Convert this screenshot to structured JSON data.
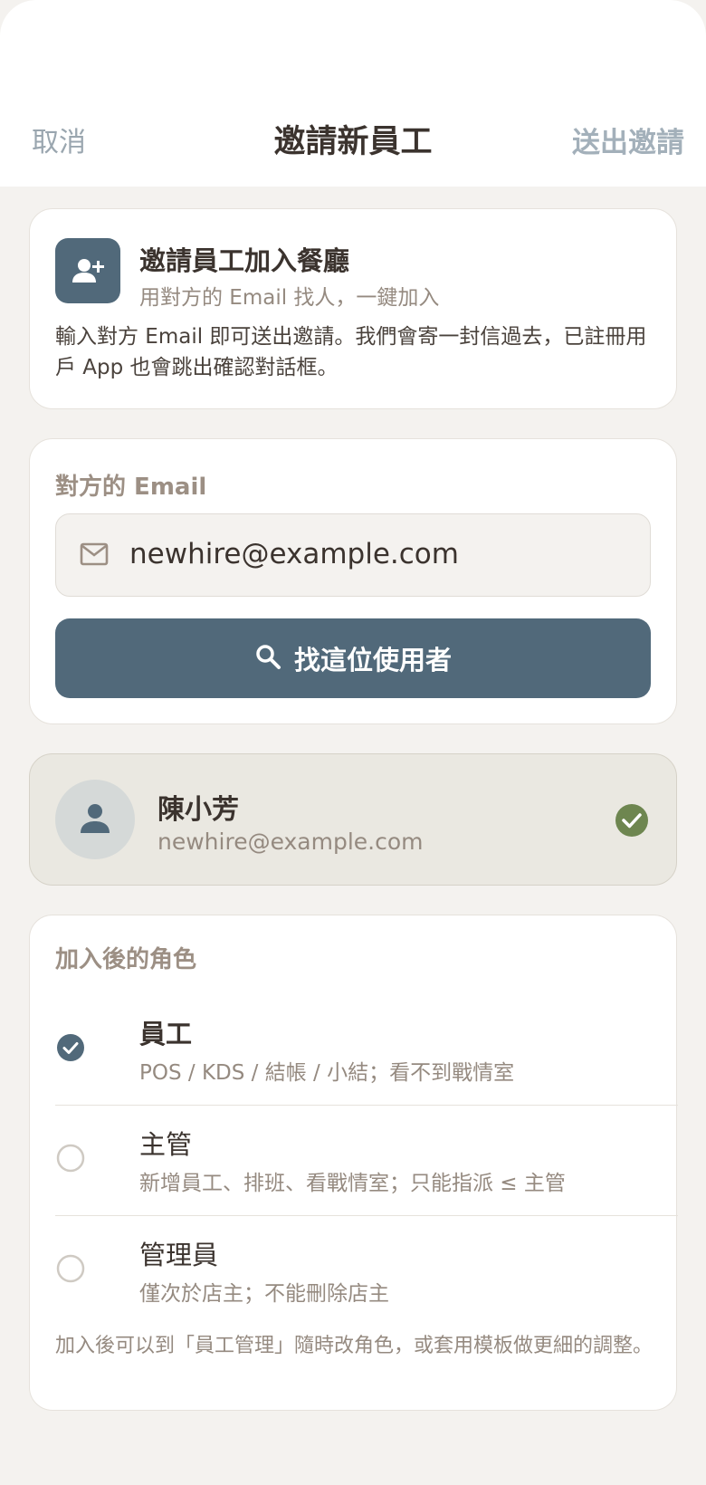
{
  "nav": {
    "cancel_label": "取消",
    "title": "邀請新員工",
    "send_label": "送出邀請"
  },
  "intro": {
    "icon": "add-person-icon",
    "title": "邀請員工加入餐廳",
    "subtitle": "用對方的 Email 找人，一鍵加入",
    "body": "輸入對方 Email 即可送出邀請。我們會寄一封信過去，已註冊用戶 App 也會跳出確認對話框。"
  },
  "email_section": {
    "label": "對方的 Email",
    "icon": "mail-icon",
    "value": "newhire@example.com",
    "find_button_icon": "search-icon",
    "find_button_label": "找這位使用者"
  },
  "found_user": {
    "icon": "person-icon",
    "name": "陳小芳",
    "email": "newhire@example.com",
    "status_icon": "check-circle-icon"
  },
  "role_section": {
    "label": "加入後的角色",
    "roles": [
      {
        "name": "員工",
        "description": "POS / KDS / 結帳 / 小結；看不到戰情室",
        "selected": true
      },
      {
        "name": "主管",
        "description": "新增員工、排班、看戰情室；只能指派 ≤ 主管",
        "selected": false
      },
      {
        "name": "管理員",
        "description": "僅次於店主；不能刪除店主",
        "selected": false
      }
    ],
    "note": "加入後可以到「員工管理」隨時改角色，或套用模板做更細的調整。"
  },
  "colors": {
    "accent": "#51697a",
    "success": "#6e8650",
    "background": "#f4f2ef",
    "muted_text": "#958a80"
  }
}
